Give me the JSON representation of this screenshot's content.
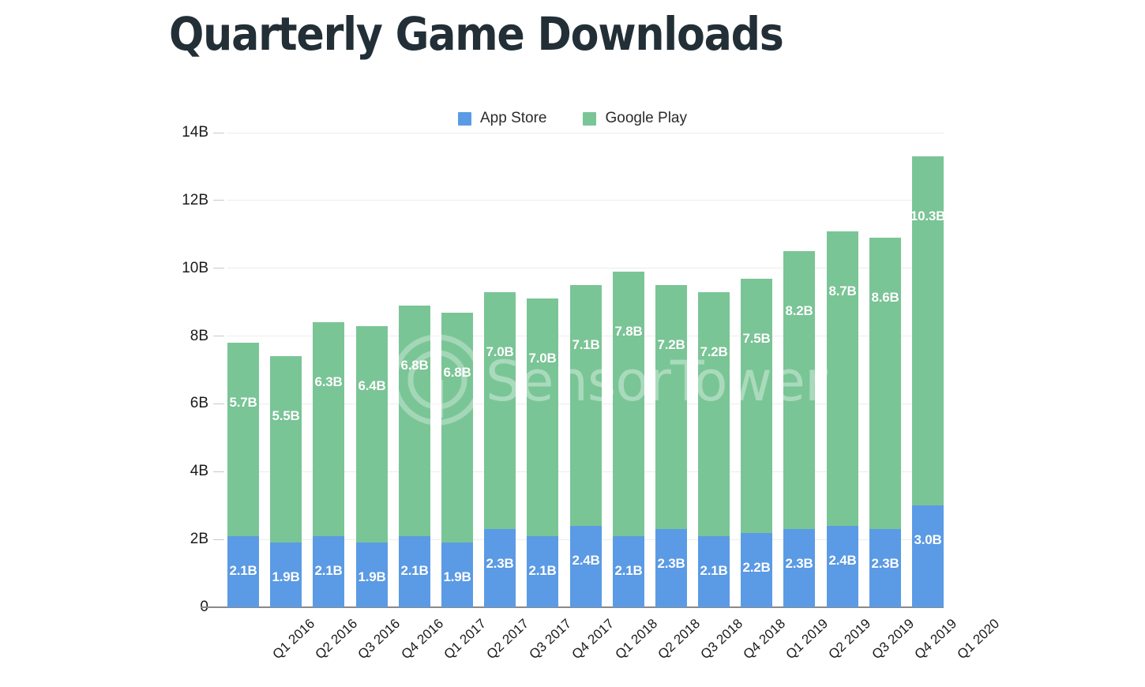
{
  "title": "Quarterly Game Downloads",
  "watermark": {
    "text": "SensorTower",
    "logo_icon": "sensortower-circle-logo-icon"
  },
  "legend": {
    "position": "top-center",
    "items": [
      {
        "label": "App Store",
        "color": "#5B9BE5",
        "icon": "legend-swatch-icon"
      },
      {
        "label": "Google Play",
        "color": "#7AC596",
        "icon": "legend-swatch-icon"
      }
    ]
  },
  "axes": {
    "y_ticks": [
      "0",
      "2B",
      "4B",
      "6B",
      "8B",
      "10B",
      "12B",
      "14B"
    ],
    "y_tick_values": [
      0,
      2,
      4,
      6,
      8,
      10,
      12,
      14
    ],
    "ylim": [
      0,
      14
    ],
    "grid": true,
    "xlabel": "",
    "ylabel": ""
  },
  "chart_data": {
    "type": "bar",
    "stacked": true,
    "title": "Quarterly Game Downloads",
    "xlabel": "",
    "ylabel": "",
    "ylim": [
      0,
      14
    ],
    "unit": "B",
    "grid": true,
    "legend_position": "top-center",
    "categories": [
      "Q1 2016",
      "Q2 2016",
      "Q3 2016",
      "Q4 2016",
      "Q1 2017",
      "Q2 2017",
      "Q3 2017",
      "Q4 2017",
      "Q1 2018",
      "Q2 2018",
      "Q3 2018",
      "Q4 2018",
      "Q1 2019",
      "Q2 2019",
      "Q3 2019",
      "Q4 2019",
      "Q1 2020"
    ],
    "series": [
      {
        "name": "App Store",
        "color": "#5B9BE5",
        "values": [
          2.1,
          1.9,
          2.1,
          1.9,
          2.1,
          1.9,
          2.3,
          2.1,
          2.4,
          2.1,
          2.3,
          2.1,
          2.2,
          2.3,
          2.4,
          2.3,
          3.0
        ],
        "labels": [
          "2.1B",
          "1.9B",
          "2.1B",
          "1.9B",
          "2.1B",
          "1.9B",
          "2.3B",
          "2.1B",
          "2.4B",
          "2.1B",
          "2.3B",
          "2.1B",
          "2.2B",
          "2.3B",
          "2.4B",
          "2.3B",
          "3.0B"
        ]
      },
      {
        "name": "Google Play",
        "color": "#7AC596",
        "values": [
          5.7,
          5.5,
          6.3,
          6.4,
          6.8,
          6.8,
          7.0,
          7.0,
          7.1,
          7.8,
          7.2,
          7.2,
          7.5,
          8.2,
          8.7,
          8.6,
          10.3
        ],
        "labels": [
          "5.7B",
          "5.5B",
          "6.3B",
          "6.4B",
          "6.8B",
          "6.8B",
          "7.0B",
          "7.0B",
          "7.1B",
          "7.8B",
          "7.2B",
          "7.2B",
          "7.5B",
          "8.2B",
          "8.7B",
          "8.6B",
          "10.3B"
        ]
      }
    ],
    "totals": [
      7.8,
      7.4,
      8.4,
      8.3,
      8.9,
      8.7,
      9.3,
      9.1,
      9.5,
      9.9,
      9.5,
      9.3,
      9.7,
      10.5,
      11.1,
      10.9,
      13.3
    ]
  },
  "colors": {
    "app_store": "#5B9BE5",
    "google_play": "#7AC596",
    "title": "#232F37",
    "gridline": "#ececed",
    "axis": "#8a8a8a",
    "background": "#ffffff"
  }
}
